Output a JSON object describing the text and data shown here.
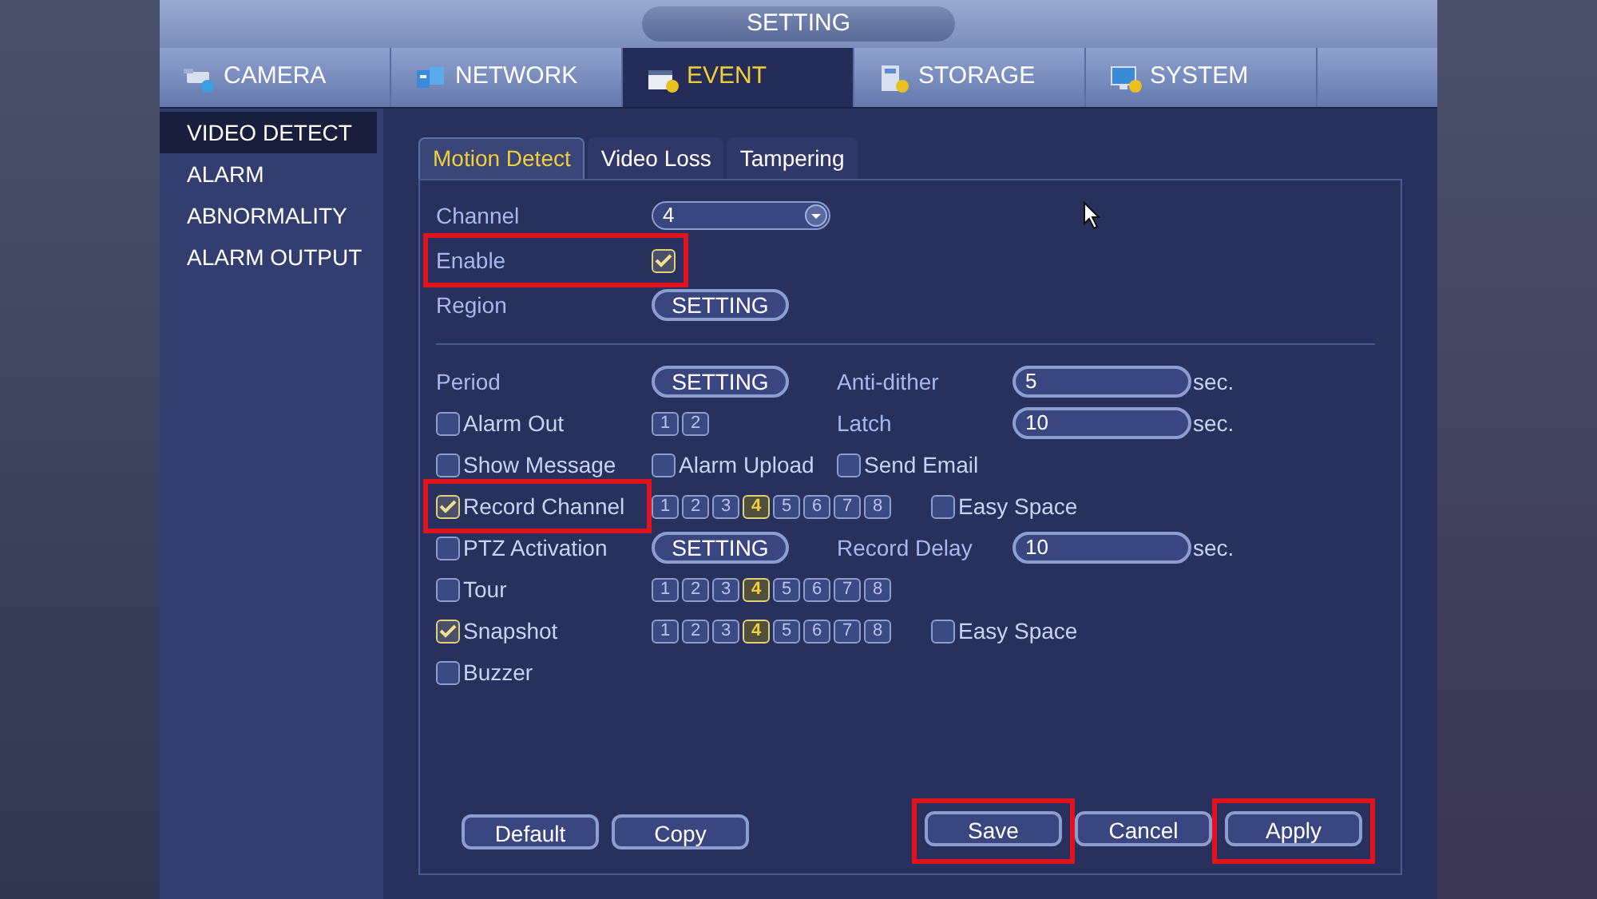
{
  "title": "SETTING",
  "main_tabs": [
    {
      "label": "CAMERA",
      "kind": "camera",
      "selected": false
    },
    {
      "label": "NETWORK",
      "kind": "network",
      "selected": false
    },
    {
      "label": "EVENT",
      "kind": "event",
      "selected": true
    },
    {
      "label": "STORAGE",
      "kind": "storage",
      "selected": false
    },
    {
      "label": "SYSTEM",
      "kind": "system",
      "selected": false
    }
  ],
  "sidebar": {
    "items": [
      {
        "label": "VIDEO DETECT",
        "selected": true
      },
      {
        "label": "ALARM",
        "selected": false
      },
      {
        "label": "ABNORMALITY",
        "selected": false
      },
      {
        "label": "ALARM OUTPUT",
        "selected": false
      }
    ]
  },
  "sub_tabs": [
    {
      "label": "Motion Detect",
      "selected": true
    },
    {
      "label": "Video Loss",
      "selected": false
    },
    {
      "label": "Tampering",
      "selected": false
    }
  ],
  "top_rows": [
    [
      {
        "kind": "label",
        "text": "Channel"
      },
      {
        "kind": "select",
        "value": "4"
      }
    ],
    [
      {
        "kind": "label",
        "text": "Enable",
        "highlighted": true
      },
      {
        "kind": "checkbox",
        "checked": true,
        "highlighted": true
      }
    ],
    [
      {
        "kind": "label",
        "text": "Region"
      },
      {
        "kind": "button",
        "text": "SETTING"
      }
    ]
  ],
  "rows": [
    [
      {
        "kind": "label",
        "text": "Period"
      },
      {
        "kind": "button",
        "text": "SETTING"
      },
      {
        "kind": "label",
        "text": "Anti-dither"
      },
      {
        "kind": "input",
        "value": "5",
        "unit": "sec."
      }
    ],
    [
      {
        "kind": "checkbox",
        "text": "Alarm Out",
        "checked": false
      },
      {
        "kind": "channels",
        "items": [
          {
            "label": "1",
            "selected": false
          },
          {
            "label": "2",
            "selected": false
          }
        ]
      },
      {
        "kind": "label",
        "text": "Latch"
      },
      {
        "kind": "input",
        "value": "10",
        "unit": "sec."
      }
    ],
    [
      {
        "kind": "checkbox",
        "text": "Show Message",
        "checked": false
      },
      {
        "kind": "checkbox",
        "text": "Alarm Upload",
        "checked": false
      },
      {
        "kind": "checkbox",
        "text": "Send Email",
        "checked": false
      }
    ],
    [
      {
        "kind": "checkbox",
        "text": "Record Channel",
        "checked": true,
        "highlighted": true
      },
      {
        "kind": "channels",
        "items": [
          {
            "label": "1",
            "selected": false
          },
          {
            "label": "2",
            "selected": false
          },
          {
            "label": "3",
            "selected": false
          },
          {
            "label": "4",
            "selected": true
          },
          {
            "label": "5",
            "selected": false
          },
          {
            "label": "6",
            "selected": false
          },
          {
            "label": "7",
            "selected": false
          },
          {
            "label": "8",
            "selected": false
          }
        ]
      },
      {
        "kind": "checkbox",
        "text": "Easy Space",
        "checked": false
      }
    ],
    [
      {
        "kind": "checkbox",
        "text": "PTZ Activation",
        "checked": false
      },
      {
        "kind": "button",
        "text": "SETTING"
      },
      {
        "kind": "label",
        "text": "Record Delay"
      },
      {
        "kind": "input",
        "value": "10",
        "unit": "sec."
      }
    ],
    [
      {
        "kind": "checkbox",
        "text": "Tour",
        "checked": false
      },
      {
        "kind": "channels",
        "items": [
          {
            "label": "1",
            "selected": false
          },
          {
            "label": "2",
            "selected": false
          },
          {
            "label": "3",
            "selected": false
          },
          {
            "label": "4",
            "selected": true
          },
          {
            "label": "5",
            "selected": false
          },
          {
            "label": "6",
            "selected": false
          },
          {
            "label": "7",
            "selected": false
          },
          {
            "label": "8",
            "selected": false
          }
        ]
      }
    ],
    [
      {
        "kind": "checkbox",
        "text": "Snapshot",
        "checked": true
      },
      {
        "kind": "channels",
        "items": [
          {
            "label": "1",
            "selected": false
          },
          {
            "label": "2",
            "selected": false
          },
          {
            "label": "3",
            "selected": false
          },
          {
            "label": "4",
            "selected": true
          },
          {
            "label": "5",
            "selected": false
          },
          {
            "label": "6",
            "selected": false
          },
          {
            "label": "7",
            "selected": false
          },
          {
            "label": "8",
            "selected": false
          }
        ]
      },
      {
        "kind": "checkbox",
        "text": "Easy Space",
        "checked": false
      }
    ],
    [
      {
        "kind": "checkbox",
        "text": "Buzzer",
        "checked": false
      }
    ]
  ],
  "left_buttons": [
    {
      "label": "Default",
      "highlighted": false
    },
    {
      "label": "Copy",
      "highlighted": false
    }
  ],
  "right_buttons": [
    {
      "label": "Save",
      "highlighted": true
    },
    {
      "label": "Cancel",
      "highlighted": false
    },
    {
      "label": "Apply",
      "highlighted": true
    }
  ]
}
